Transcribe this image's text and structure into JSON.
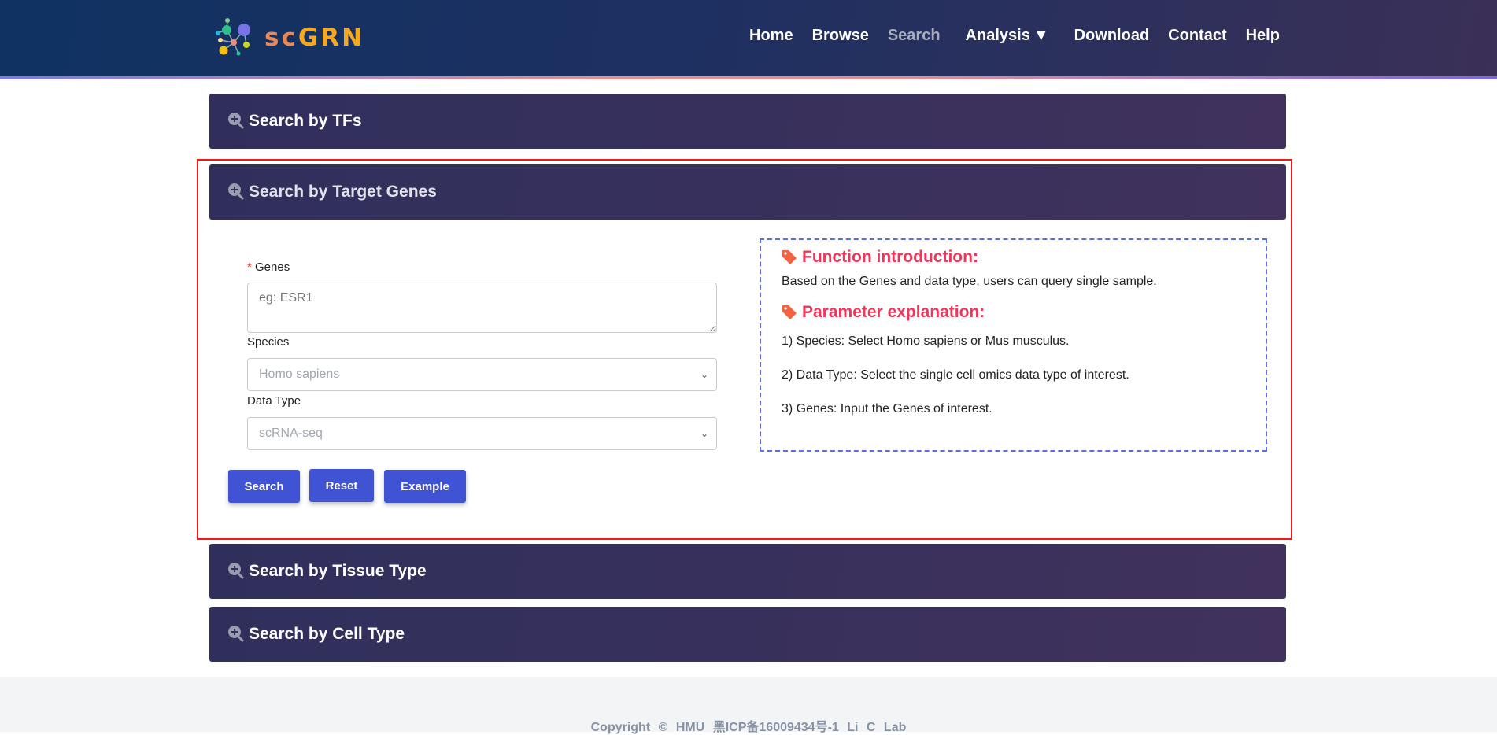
{
  "brand": {
    "sc": "sc",
    "grn": "GRN"
  },
  "nav": {
    "items": [
      "Home",
      "Browse",
      "Search",
      "Analysis",
      "Download",
      "Contact",
      "Help"
    ],
    "active": "Search"
  },
  "panels": [
    "Search by TFs",
    "Search by Target Genes",
    "Search by Tissue Type",
    "Search by Cell Type"
  ],
  "form": {
    "genes_required": "*",
    "genes_label": "Genes",
    "genes_placeholder": "eg: ESR1",
    "species_label": "Species",
    "species_value": "Homo sapiens",
    "datatype_label": "Data Type",
    "datatype_value": "scRNA-seq",
    "search": "Search",
    "reset": "Reset",
    "example": "Example"
  },
  "info": {
    "func_title": "Function introduction:",
    "func_text": "Based on the Genes and data type, users can query single sample.",
    "param_title": "Parameter explanation:",
    "params": [
      "1) Species: Select Homo sapiens or Mus musculus.",
      "2) Data Type: Select the single cell omics data type of interest.",
      "3) Genes: Input the Genes of interest."
    ]
  },
  "footer": "Copyright © HMU  黑ICP备16009434号-1  Li C Lab",
  "colors": {
    "accent": "#3f53d4",
    "highlight": "#f01919",
    "heading": "#f0365a"
  }
}
